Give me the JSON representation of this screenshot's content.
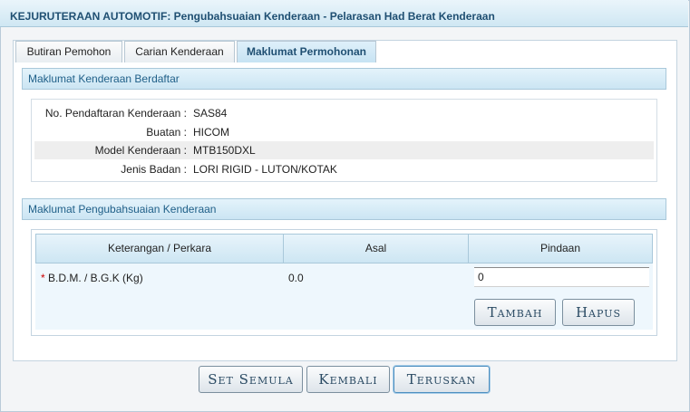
{
  "window": {
    "title": "KEJURUTERAAN AUTOMOTIF: Pengubahsuaian Kenderaan - Pelarasan Had Berat Kenderaan"
  },
  "tabs": [
    {
      "label": "Butiran Pemohon"
    },
    {
      "label": "Carian Kenderaan"
    },
    {
      "label": "Maklumat Permohonan",
      "active": true
    }
  ],
  "vehicle_section": {
    "heading": "Maklumat Kenderaan Berdaftar",
    "fields": [
      {
        "label": "No. Pendaftaran Kenderaan :",
        "value": "SAS84"
      },
      {
        "label": "Buatan :",
        "value": "HICOM"
      },
      {
        "label": "Model Kenderaan :",
        "value": "MTB150DXL"
      },
      {
        "label": "Jenis Badan :",
        "value": "LORI RIGID - LUTON/KOTAK"
      }
    ]
  },
  "modification_section": {
    "heading": "Maklumat Pengubahsuaian Kenderaan",
    "columns": [
      "Keterangan / Perkara",
      "Asal",
      "Pindaan"
    ],
    "rows": [
      {
        "required_mark": "*",
        "item": "B.D.M. / B.G.K (Kg)",
        "asal": "0.0",
        "pindaan": "0"
      }
    ],
    "buttons": {
      "add": "Tambah",
      "delete": "Hapus"
    }
  },
  "footer_buttons": {
    "reset": "Set Semula",
    "back": "Kembali",
    "next": "Teruskan"
  }
}
